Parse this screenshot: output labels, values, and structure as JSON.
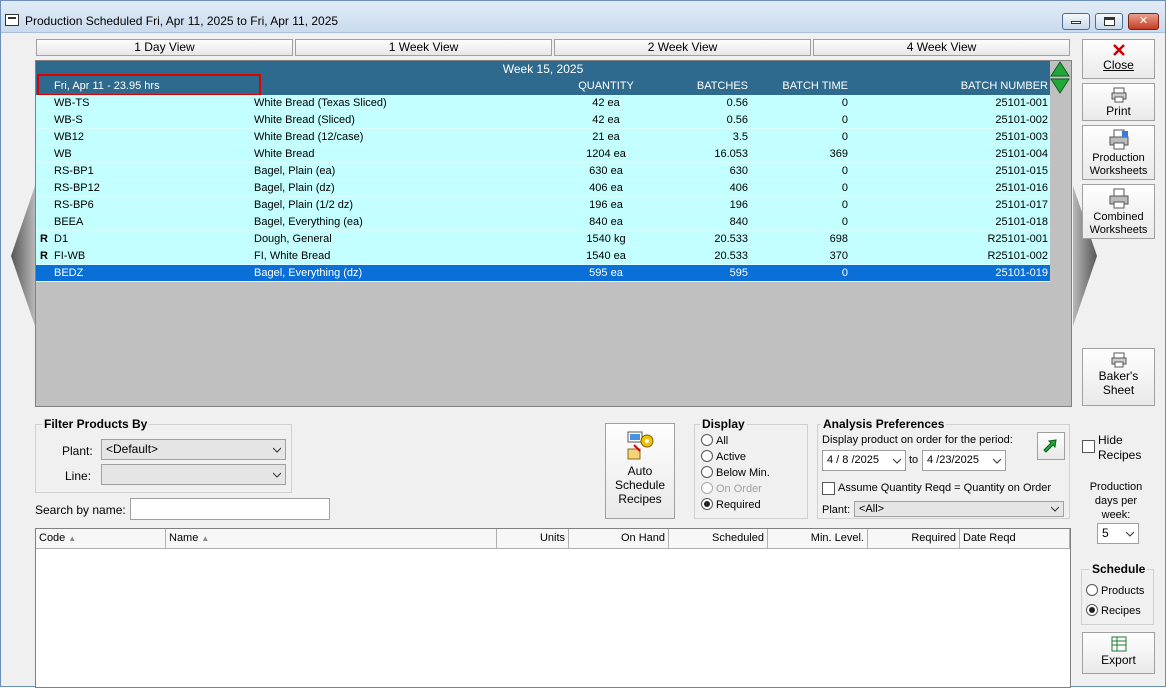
{
  "window": {
    "title": "Production Scheduled Fri, Apr 11, 2025 to Fri, Apr 11, 2025"
  },
  "view_tabs": [
    "1 Day View",
    "1 Week View",
    "2 Week View",
    "4 Week View"
  ],
  "grid": {
    "week_label": "Week 15, 2025",
    "day_label": "Fri, Apr 11 - 23.95 hrs",
    "columns": {
      "quantity": "QUANTITY",
      "batches": "BATCHES",
      "batch_time": "BATCH TIME",
      "batch_number": "BATCH NUMBER"
    },
    "rows": [
      {
        "flag": "",
        "code": "WB-TS",
        "name": "White Bread (Texas Sliced)",
        "qty": "42 ea",
        "batches": "0.56",
        "batch_time": "0",
        "batch_number": "25101-001"
      },
      {
        "flag": "",
        "code": "WB-S",
        "name": "White Bread (Sliced)",
        "qty": "42 ea",
        "batches": "0.56",
        "batch_time": "0",
        "batch_number": "25101-002"
      },
      {
        "flag": "",
        "code": "WB12",
        "name": "White Bread (12/case)",
        "qty": "21 ea",
        "batches": "3.5",
        "batch_time": "0",
        "batch_number": "25101-003"
      },
      {
        "flag": "",
        "code": "WB",
        "name": "White Bread",
        "qty": "1204 ea",
        "batches": "16.053",
        "batch_time": "369",
        "batch_number": "25101-004"
      },
      {
        "flag": "",
        "code": "RS-BP1",
        "name": "Bagel, Plain (ea)",
        "qty": "630 ea",
        "batches": "630",
        "batch_time": "0",
        "batch_number": "25101-015"
      },
      {
        "flag": "",
        "code": "RS-BP12",
        "name": "Bagel, Plain (dz)",
        "qty": "406 ea",
        "batches": "406",
        "batch_time": "0",
        "batch_number": "25101-016"
      },
      {
        "flag": "",
        "code": "RS-BP6",
        "name": "Bagel, Plain (1/2 dz)",
        "qty": "196 ea",
        "batches": "196",
        "batch_time": "0",
        "batch_number": "25101-017"
      },
      {
        "flag": "",
        "code": "BEEA",
        "name": "Bagel, Everything (ea)",
        "qty": "840 ea",
        "batches": "840",
        "batch_time": "0",
        "batch_number": "25101-018"
      },
      {
        "flag": "R",
        "code": "D1",
        "name": "Dough, General",
        "qty": "1540 kg",
        "batches": "20.533",
        "batch_time": "698",
        "batch_number": "R25101-001"
      },
      {
        "flag": "R",
        "code": "FI-WB",
        "name": "FI, White Bread",
        "qty": "1540 ea",
        "batches": "20.533",
        "batch_time": "370",
        "batch_number": "R25101-002"
      },
      {
        "flag": "",
        "code": "BEDZ",
        "name": "Bagel, Everything (dz)",
        "qty": "595 ea",
        "batches": "595",
        "batch_time": "0",
        "batch_number": "25101-019",
        "selected": true
      }
    ]
  },
  "toolbar": {
    "close": "Close",
    "print": "Print",
    "production_worksheets": [
      "Production",
      "Worksheets"
    ],
    "combined_worksheets": [
      "Combined",
      "Worksheets"
    ],
    "bakers_sheet": [
      "Baker's",
      "Sheet"
    ],
    "export": "Export"
  },
  "filter": {
    "title": "Filter Products By",
    "plant_label": "Plant:",
    "plant_value": "<Default>",
    "line_label": "Line:",
    "line_value": "",
    "search_label": "Search by name:",
    "search_value": ""
  },
  "auto_schedule": [
    "Auto",
    "Schedule",
    "Recipes"
  ],
  "display": {
    "title": "Display",
    "options": [
      "All",
      "Active",
      "Below Min.",
      "On Order",
      "Required"
    ],
    "selected": "Required",
    "disabled": "On Order"
  },
  "analysis": {
    "title": "Analysis Preferences",
    "period_label": "Display product on order for the period:",
    "from_date": "4 / 8 /2025",
    "to_label": "to",
    "to_date": "4 /23/2025",
    "assume_label": "Assume Quantity Reqd = Quantity on Order",
    "plant_label": "Plant:",
    "plant_value": "<All>"
  },
  "right_panel": {
    "hide_recipes": [
      "Hide",
      "Recipes"
    ],
    "prod_days_label": [
      "Production",
      "days per",
      "week:"
    ],
    "prod_days_value": "5",
    "schedule_title": "Schedule",
    "schedule_options": [
      "Products",
      "Recipes"
    ],
    "schedule_selected": "Recipes"
  },
  "products_table": {
    "columns": [
      "Code",
      "Name",
      "Units",
      "On Hand",
      "Scheduled",
      "Min. Level.",
      "Required",
      "Date Reqd"
    ]
  }
}
